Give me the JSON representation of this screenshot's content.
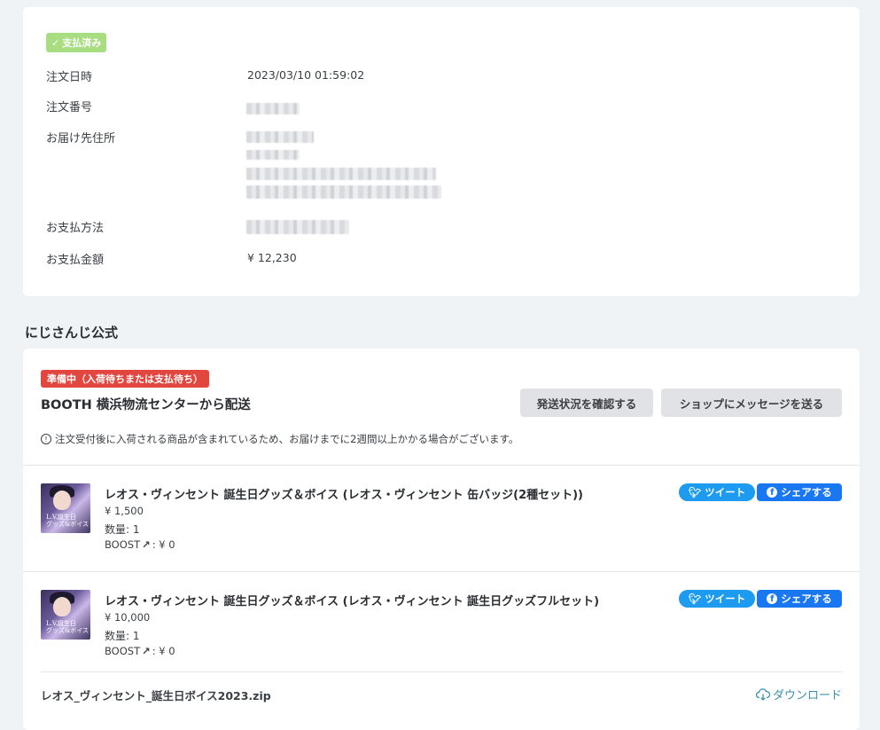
{
  "order": {
    "status_badge": "支払済み",
    "rows": [
      {
        "label": "注文日時",
        "value": "2023/03/10 01:59:02"
      },
      {
        "label": "注文番号",
        "value": ""
      },
      {
        "label": "お届け先住所",
        "value": ""
      },
      {
        "label": "お支払方法",
        "value": ""
      },
      {
        "label": "お支払金額",
        "value": "¥ 12,230"
      }
    ]
  },
  "shop": {
    "name": "にじさんじ公式",
    "status_badge": "準備中（入荷待ちまたは支払待ち）",
    "shipping_title": "BOOTH 横浜物流センターから配送",
    "check_shipping_button": "発送状況を確認する",
    "message_shop_button": "ショップにメッセージを送る",
    "notice": "注文受付後に入荷される商品が含まれているため、お届けまでに2週間以上かかる場合がございます。",
    "notice_icon": "info-icon",
    "items": [
      {
        "title": "レオス・ヴィンセント 誕生日グッズ＆ボイス (レオス・ヴィンセント 缶バッジ(2種セット))",
        "price": "¥ 1,500",
        "quantity": "数量: 1",
        "boost": "BOOST",
        "boost_value": ": ¥ 0",
        "tweet": "ツイート",
        "share": "シェアする"
      },
      {
        "title": "レオス・ヴィンセント 誕生日グッズ＆ボイス (レオス・ヴィンセント 誕生日グッズフルセット)",
        "price": "¥ 10,000",
        "quantity": "数量: 1",
        "boost": "BOOST",
        "boost_value": ": ¥ 0",
        "tweet": "ツイート",
        "share": "シェアする"
      }
    ],
    "file": {
      "name": "レオス_ヴィンセント_誕生日ボイス2023.zip",
      "download": "ダウンロード"
    }
  },
  "colors": {
    "paid_badge": "#a8dd82",
    "status_badge": "#e2463f",
    "twitter": "#1c9bf0",
    "facebook": "#1a77f2",
    "link": "#3d8fb0"
  }
}
